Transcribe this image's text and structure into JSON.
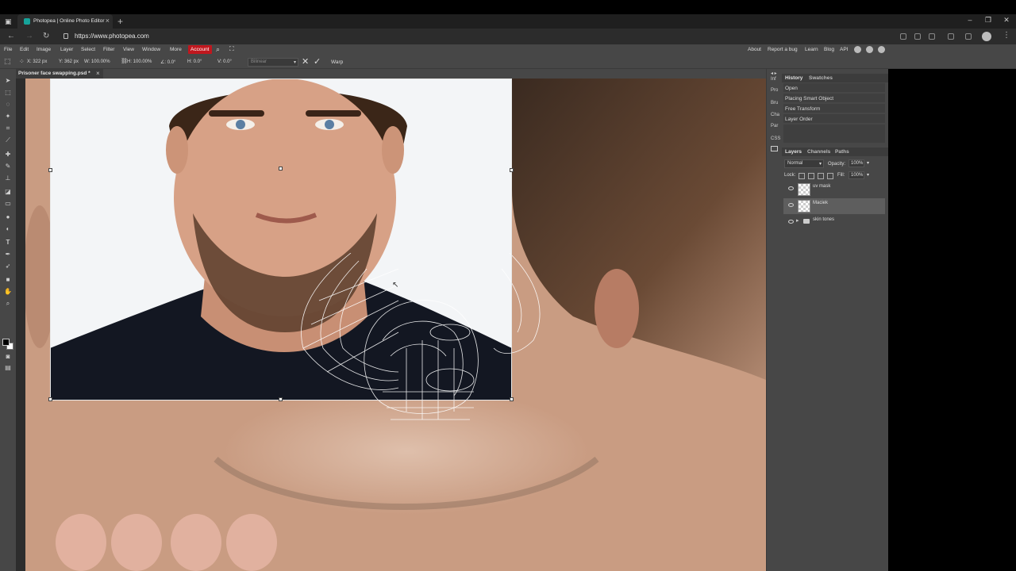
{
  "browser": {
    "tab_title": "Photopea | Online Photo Editor",
    "tab_close": "×",
    "new_tab": "+",
    "url": "https://www.photopea.com",
    "window_controls": [
      "–",
      "❐",
      "✕"
    ]
  },
  "menu": {
    "items": [
      "File",
      "Edit",
      "Image",
      "Layer",
      "Select",
      "Filter",
      "View",
      "Window",
      "More"
    ],
    "account": "Account",
    "right_links": [
      "About",
      "Report a bug",
      "Learn",
      "Blog",
      "API"
    ]
  },
  "options": {
    "x": "X: 322 px",
    "y": "Y: 362 px",
    "w": "W: 100.00%",
    "h": "H: 100.00%",
    "angle": "∠: 0.0°",
    "skew_h": "H: 0.0°",
    "skew_v": "V: 0.0°",
    "interpolation": "Bilinear",
    "warp": "Warp"
  },
  "document": {
    "title": "Prisoner face swapping.psd *",
    "close": "×"
  },
  "mini_panel": [
    "Inf",
    "Pro",
    "Bru",
    "Cha",
    "Par",
    "CSS"
  ],
  "history": {
    "tabs": [
      "History",
      "Swatches"
    ],
    "items": [
      "Open",
      "Placing Smart Object",
      "Free Transform",
      "Layer Order"
    ]
  },
  "layers": {
    "tabs": [
      "Layers",
      "Channels",
      "Paths"
    ],
    "blend_mode": "Normal",
    "opacity_label": "Opacity:",
    "opacity_value": "100%",
    "lock_label": "Lock:",
    "fill_label": "Fill:",
    "fill_value": "100%",
    "rows": [
      {
        "name": "uv mask",
        "type": "layer",
        "selected": false
      },
      {
        "name": "Maciek",
        "type": "layer",
        "selected": true
      },
      {
        "name": "skin tones",
        "type": "folder",
        "selected": false
      }
    ]
  },
  "colors": {
    "account_red": "#c0171e",
    "skin": "#c99c82",
    "panel_bg": "#474747"
  }
}
